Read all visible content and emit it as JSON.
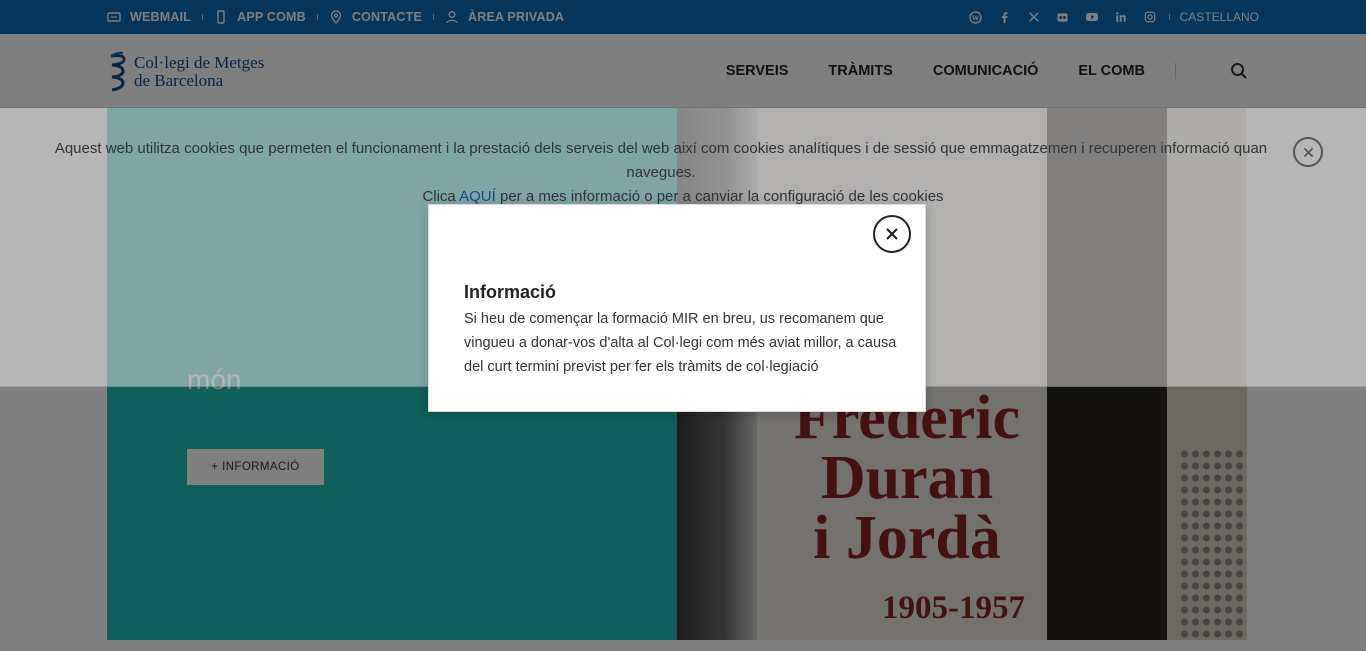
{
  "topbar": {
    "links": [
      {
        "label": "WEBMAIL",
        "icon": "webmail-icon"
      },
      {
        "label": "APP COMB",
        "icon": "mobile-icon"
      },
      {
        "label": "CONTACTE",
        "icon": "location-pin-icon"
      },
      {
        "label": "ÀREA PRIVADA",
        "icon": "user-icon"
      }
    ],
    "social_icons": [
      "wordpress-icon",
      "facebook-icon",
      "x-icon",
      "flickr-icon",
      "youtube-icon",
      "linkedin-icon",
      "instagram-icon"
    ],
    "language": "CASTELLANO"
  },
  "header": {
    "logo_line1": "Col·legi de Metges",
    "logo_line2": "de Barcelona",
    "nav": [
      "SERVEIS",
      "TRÀMITS",
      "COMUNICACIÓ",
      "EL COMB"
    ]
  },
  "hero": {
    "text_fragment": "món",
    "button_label": "+ INFORMACIÓ",
    "image_title_1": "Frederic",
    "image_title_2": "Duran",
    "image_title_3": "i Jordà",
    "image_years": "1905-1957"
  },
  "cookie_banner": {
    "text": "Aquest web utilitza cookies que permeten el funcionament i la prestació dels serveis del web així com cookies analítiques i de sessió que emmagatzemen i recuperen informació quan navegues.",
    "prefix": "Clica ",
    "link": "AQUÍ",
    "suffix": " per a mes informació o per a canviar la configuració de les cookies"
  },
  "modal": {
    "title": "Informació",
    "body": "Si heu de començar la formació MIR en breu, us recomanem que vingueu a donar-vos d'alta al Col·legi com més aviat millor, a causa del curt termini previst per fer els tràmits de col·legiació"
  },
  "colors": {
    "topbar": "#0a6ab4",
    "teal": "#1fbfb6",
    "brand": "#0a4d8c"
  }
}
